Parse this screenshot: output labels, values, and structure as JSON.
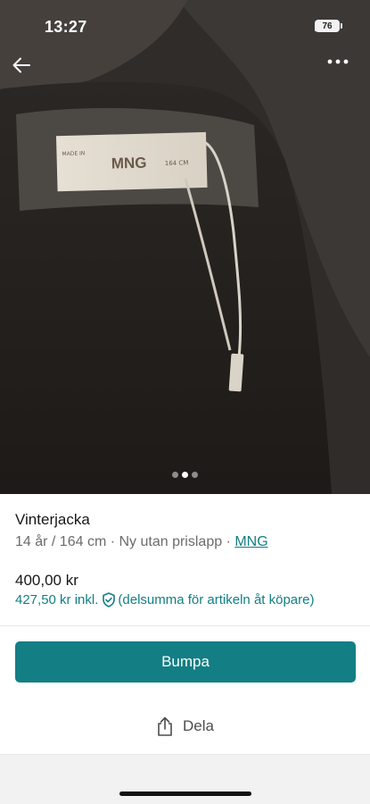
{
  "status_bar": {
    "time": "13:27",
    "battery": "76"
  },
  "photo": {
    "label_brand": "MNG",
    "label_size": "164 CM",
    "carousel": {
      "count": 3,
      "active_index": 1
    }
  },
  "item": {
    "title": "Vinterjacka",
    "meta": "14 år / 164 cm · Ny utan prislapp · ",
    "brand": "MNG",
    "price": "400,00 kr",
    "price_incl": "427,50 kr inkl.",
    "price_incl_note": "(delsumma för artikeln åt köpare)"
  },
  "actions": {
    "bump_label": "Bumpa",
    "share_label": "Dela"
  },
  "colors": {
    "accent": "#137e84",
    "text": "#171717",
    "muted": "#6c6c6c"
  }
}
